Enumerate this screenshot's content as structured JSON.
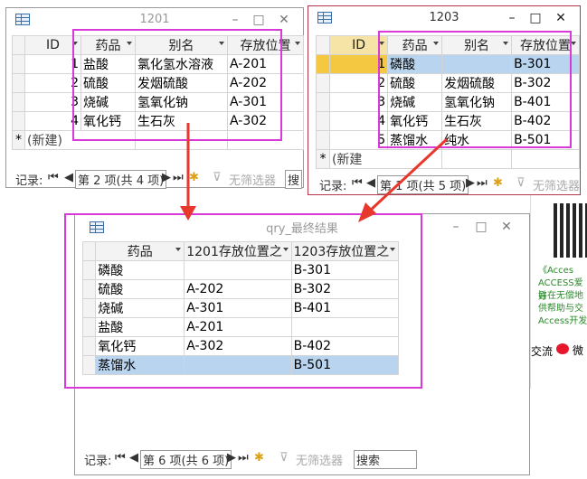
{
  "win1201": {
    "title": "1201",
    "columns": [
      "ID",
      "药品",
      "别名",
      "存放位置"
    ],
    "rows": [
      {
        "id": "1",
        "drug": "盐酸",
        "alias": "氯化氢水溶液",
        "loc": "A-201"
      },
      {
        "id": "2",
        "drug": "硫酸",
        "alias": "发烟硫酸",
        "loc": "A-202"
      },
      {
        "id": "3",
        "drug": "烧碱",
        "alias": "氢氧化钠",
        "loc": "A-301"
      },
      {
        "id": "4",
        "drug": "氧化钙",
        "alias": "生石灰",
        "loc": "A-302"
      }
    ],
    "new_row": "(新建)",
    "new_marker": "*",
    "nav": {
      "label": "记录:",
      "position": "第 2 项(共 4 项)",
      "no_filter": "无筛选器",
      "search": "搜"
    }
  },
  "win1203": {
    "title": "1203",
    "columns": [
      "ID",
      "药品",
      "别名",
      "存放位置"
    ],
    "rows": [
      {
        "id": "1",
        "drug": "磷酸",
        "alias": "",
        "loc": "B-301"
      },
      {
        "id": "2",
        "drug": "硫酸",
        "alias": "发烟硫酸",
        "loc": "B-302"
      },
      {
        "id": "3",
        "drug": "烧碱",
        "alias": "氢氧化钠",
        "loc": "B-401"
      },
      {
        "id": "4",
        "drug": "氧化钙",
        "alias": "生石灰",
        "loc": "B-402"
      },
      {
        "id": "5",
        "drug": "蒸馏水",
        "alias": "纯水",
        "loc": "B-501"
      }
    ],
    "new_row": "(新建",
    "new_marker": "*",
    "nav": {
      "label": "记录:",
      "position": "第 1 项(共 5 项)",
      "no_filter": "无筛选器"
    }
  },
  "winResult": {
    "title": "qry_最终结果",
    "columns": [
      "药品",
      "1201存放位置之",
      "1203存放位置之"
    ],
    "rows": [
      {
        "drug": "磷酸",
        "a": "",
        "b": "B-301"
      },
      {
        "drug": "硫酸",
        "a": "A-202",
        "b": "B-302"
      },
      {
        "drug": "烧碱",
        "a": "A-301",
        "b": "B-401"
      },
      {
        "drug": "盐酸",
        "a": "A-201",
        "b": ""
      },
      {
        "drug": "氧化钙",
        "a": "A-302",
        "b": "B-402"
      },
      {
        "drug": "蒸馏水",
        "a": "",
        "b": "B-501"
      }
    ],
    "nav": {
      "label": "记录:",
      "position": "第 6 项(共 6 项)",
      "no_filter": "无筛选器",
      "search": "搜索"
    }
  },
  "background": {
    "ad_lines": [
      "《Acces",
      "ACCESS爱好",
      "旨在无偿地",
      "供帮助与交",
      "Access开发"
    ],
    "share_text": "交流",
    "weibo_text": "微"
  },
  "colors": {
    "highlight_box": "#d83ad8",
    "arrow": "#e8372c",
    "selected_cell": "#b9d4ee"
  }
}
